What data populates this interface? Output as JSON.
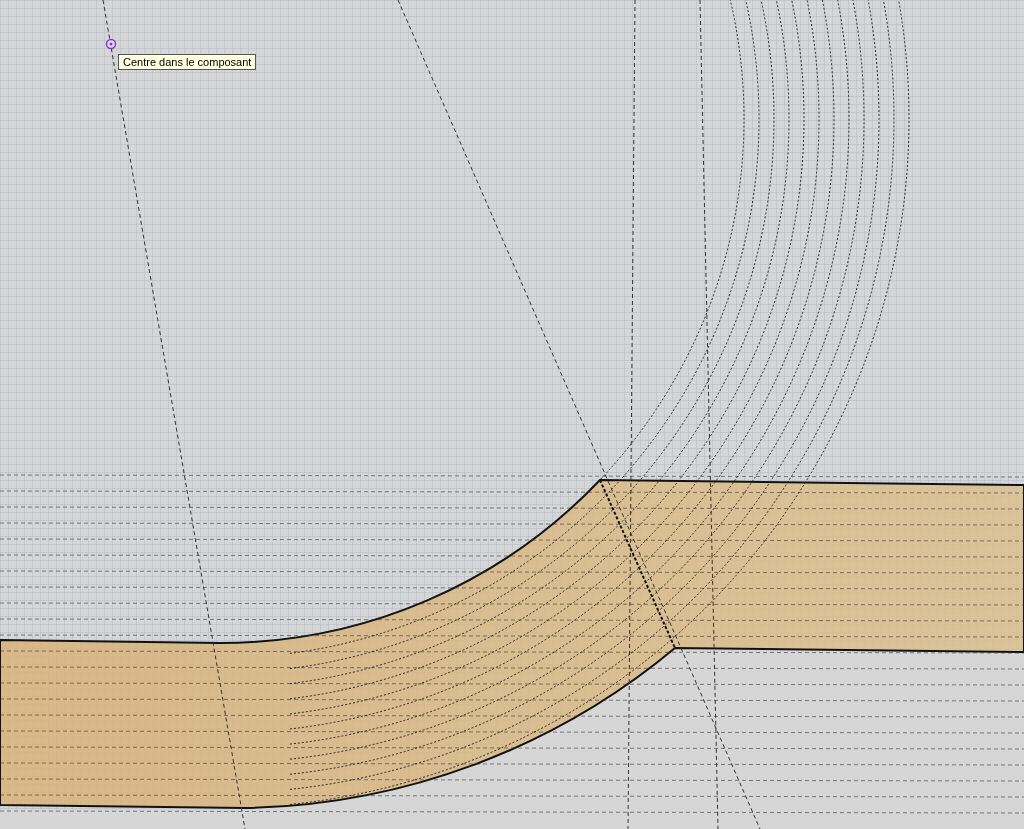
{
  "tooltip": {
    "text": "Centre dans le composant"
  }
}
